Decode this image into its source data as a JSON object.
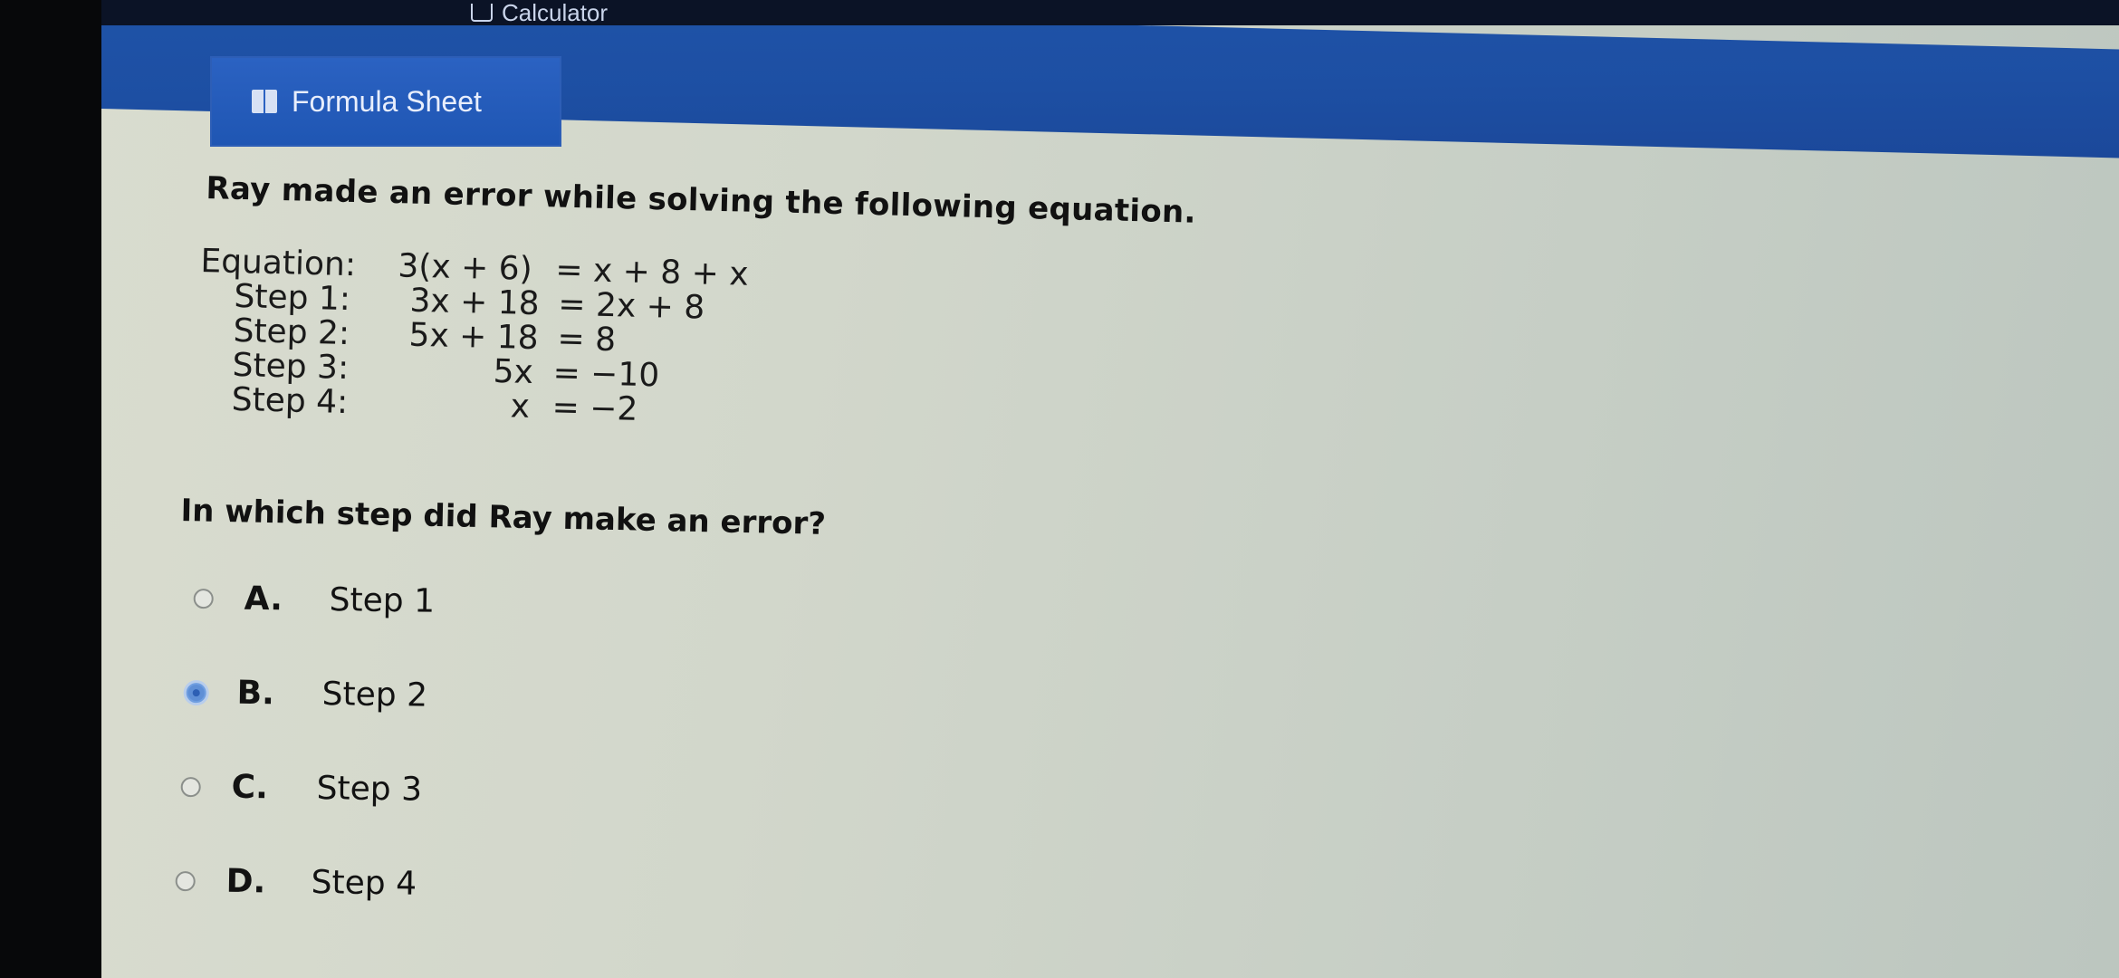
{
  "toolbar": {
    "calculator_label": "Calculator",
    "formula_sheet_label": "Formula Sheet"
  },
  "problem": {
    "prompt": "Ray made an error while solving the following equation.",
    "rows": [
      {
        "label": "Equation:",
        "lhs": "3(x + 6)",
        "rhs": "= x + 8 + x"
      },
      {
        "label": "Step 1:",
        "lhs": "3x + 18",
        "rhs": "= 2x + 8"
      },
      {
        "label": "Step 2:",
        "lhs": "5x + 18",
        "rhs": "= 8"
      },
      {
        "label": "Step 3:",
        "lhs": "5x",
        "rhs": "= −10"
      },
      {
        "label": "Step 4:",
        "lhs": "x",
        "rhs": "= −2"
      }
    ],
    "question": "In which step did Ray make an error?"
  },
  "options": [
    {
      "letter": "A.",
      "text": "Step 1",
      "selected": false
    },
    {
      "letter": "B.",
      "text": "Step 2",
      "selected": true
    },
    {
      "letter": "C.",
      "text": "Step 3",
      "selected": false
    },
    {
      "letter": "D.",
      "text": "Step 4",
      "selected": false
    }
  ],
  "colors": {
    "toolbar_blue": "#1f53a8",
    "selected_radio": "#5f8fd6"
  }
}
